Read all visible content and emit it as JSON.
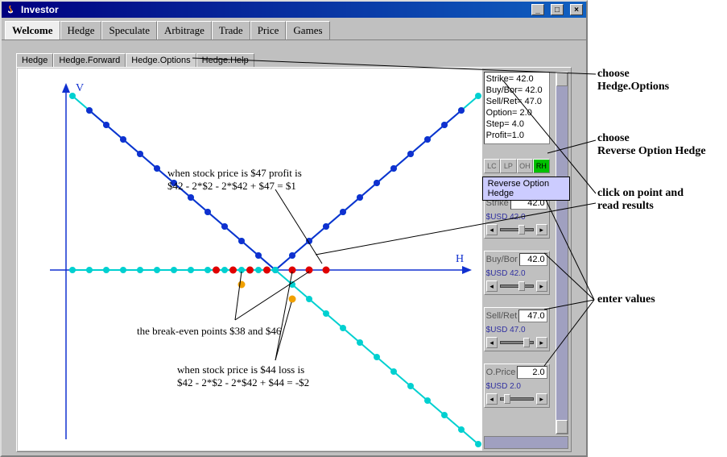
{
  "window": {
    "title": "Investor"
  },
  "main_tabs": [
    "Welcome",
    "Hedge",
    "Speculate",
    "Arbitrage",
    "Trade",
    "Price",
    "Games"
  ],
  "sub_tabs": [
    "Hedge",
    "Hedge.Forward",
    "Hedge.Options",
    "Hedge.Help"
  ],
  "chart_data": {
    "type": "line",
    "axes": {
      "x_label": "H",
      "y_label": "V"
    },
    "origin_x": 42,
    "series": [
      {
        "name": "call-upper",
        "color": "#00d0d0",
        "points": [
          [
            18,
            24
          ],
          [
            20,
            22
          ],
          [
            22,
            20
          ],
          [
            24,
            18
          ],
          [
            26,
            16
          ],
          [
            28,
            14
          ],
          [
            30,
            12
          ],
          [
            32,
            10
          ],
          [
            34,
            8
          ],
          [
            36,
            6
          ],
          [
            38,
            4
          ],
          [
            40,
            2
          ],
          [
            42,
            0
          ],
          [
            44,
            2
          ],
          [
            46,
            4
          ],
          [
            48,
            6
          ],
          [
            50,
            8
          ],
          [
            52,
            10
          ],
          [
            54,
            12
          ],
          [
            56,
            14
          ],
          [
            58,
            16
          ],
          [
            60,
            18
          ],
          [
            62,
            20
          ],
          [
            64,
            22
          ],
          [
            66,
            24
          ]
        ]
      },
      {
        "name": "call-mid",
        "color": "#1030d0",
        "points": [
          [
            20,
            22
          ],
          [
            22,
            20
          ],
          [
            24,
            18
          ],
          [
            26,
            16
          ],
          [
            28,
            14
          ],
          [
            30,
            12
          ],
          [
            32,
            10
          ],
          [
            34,
            8
          ],
          [
            36,
            6
          ],
          [
            38,
            4
          ],
          [
            40,
            2
          ],
          [
            42,
            0
          ],
          [
            44,
            2
          ],
          [
            46,
            4
          ],
          [
            48,
            6
          ],
          [
            50,
            8
          ],
          [
            52,
            10
          ],
          [
            54,
            12
          ],
          [
            56,
            14
          ],
          [
            58,
            16
          ],
          [
            60,
            18
          ],
          [
            62,
            20
          ],
          [
            64,
            22
          ]
        ]
      },
      {
        "name": "lower-flat",
        "color": "#00d0d0",
        "points": [
          [
            18,
            0
          ],
          [
            20,
            0
          ],
          [
            22,
            0
          ],
          [
            24,
            0
          ],
          [
            26,
            0
          ],
          [
            28,
            0
          ],
          [
            30,
            0
          ],
          [
            32,
            0
          ],
          [
            34,
            0
          ],
          [
            36,
            0
          ],
          [
            38,
            0
          ],
          [
            40,
            0
          ],
          [
            42,
            0
          ],
          [
            44,
            -2
          ],
          [
            46,
            -4
          ],
          [
            48,
            -6
          ],
          [
            50,
            -8
          ],
          [
            52,
            -10
          ],
          [
            54,
            -12
          ],
          [
            56,
            -14
          ],
          [
            58,
            -16
          ],
          [
            60,
            -18
          ],
          [
            62,
            -20
          ],
          [
            64,
            -22
          ],
          [
            66,
            -24
          ]
        ]
      }
    ],
    "red_points_x": [
      35,
      37,
      39,
      41,
      44,
      46,
      48
    ],
    "orange_points": [
      [
        38,
        -2
      ],
      [
        44,
        -4
      ]
    ]
  },
  "annotations": {
    "a1_l1": "when stock price is $47 profit is",
    "a1_l2": "$42 - 2*$2 - 2*$42 + $47 = $1",
    "a2": "the break-even points $38 and $46",
    "a3_l1": "when stock price is $44 loss is",
    "a3_l2": "$42 - 2*$2 - 2*$42 + $44 = -$2"
  },
  "results": {
    "strike": "Strike= 42.0",
    "buybor": "Buy/Bor= 42.0",
    "sellret": "Sell/Ret= 47.0",
    "option": "Option= 2.0",
    "step": "Step= 4.0",
    "profit": "Profit=1.0"
  },
  "strategies": {
    "lc": "LC",
    "lp": "LP",
    "oh": "OH",
    "rh": "RH"
  },
  "tooltip": "Reverse Option Hedge",
  "params": {
    "strike": {
      "label": "Strike",
      "value": "42.0",
      "usd": "$USD 42.0"
    },
    "buybor": {
      "label": "Buy/Bor",
      "value": "42.0",
      "usd": "$USD 42.0"
    },
    "sellret": {
      "label": "Sell/Ret",
      "value": "47.0",
      "usd": "$USD 47.0"
    },
    "oprice": {
      "label": "O.Price",
      "value": "2.0",
      "usd": "$USD 2.0"
    }
  },
  "guides": {
    "g1_l1": "choose",
    "g1_l2": "Hedge.Options",
    "g2_l1": "choose",
    "g2_l2": "Reverse Option Hedge",
    "g3_l1": "click on point and",
    "g3_l2": "read results",
    "g4": "enter values"
  }
}
